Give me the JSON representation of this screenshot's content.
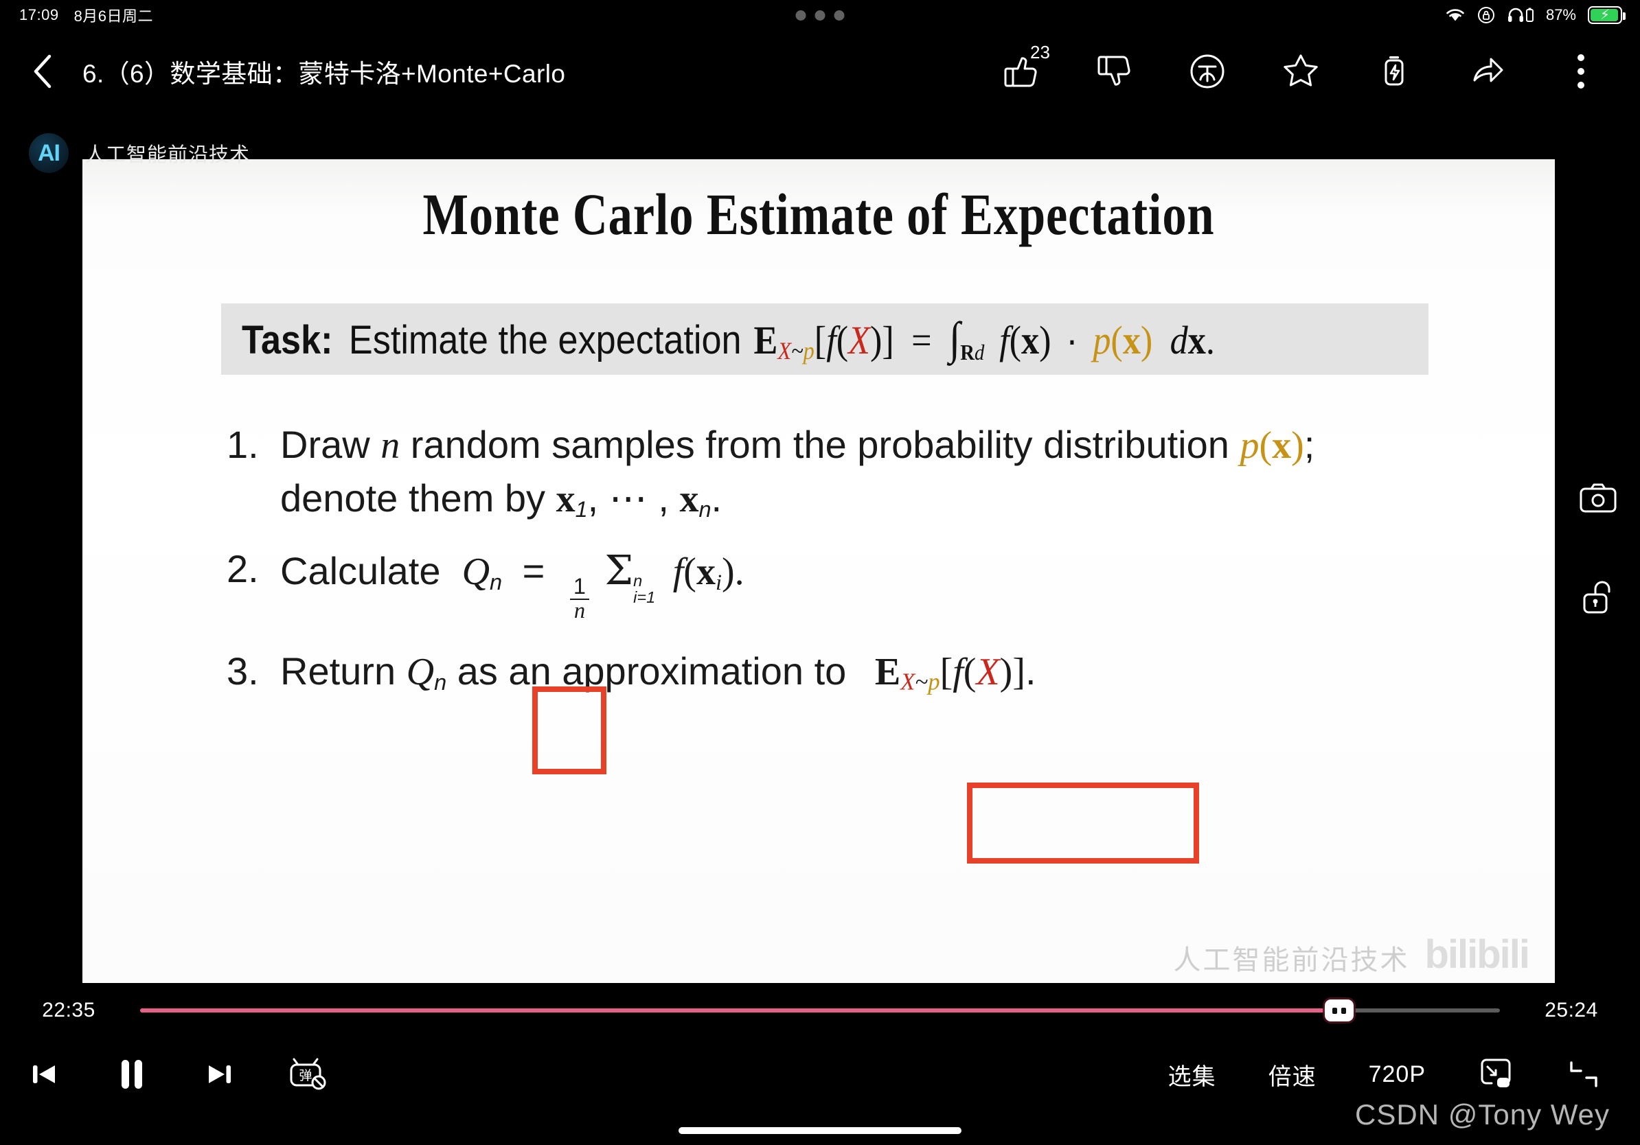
{
  "status_bar": {
    "time": "17:09",
    "date": "8月6日周二",
    "battery_percent": "87%",
    "icons": [
      "wifi-icon",
      "rotation-lock-icon",
      "headphones-battery-icon",
      "battery-charging-icon"
    ]
  },
  "top_bar": {
    "back_icon": "back-chevron-icon",
    "title": "6.（6）数学基础：蒙特卡洛+Monte+Carlo",
    "actions": [
      {
        "name": "like-button",
        "icon": "thumbs-up-icon",
        "count": "23"
      },
      {
        "name": "dislike-button",
        "icon": "thumbs-down-icon"
      },
      {
        "name": "coin-button",
        "icon": "coin-circle-icon"
      },
      {
        "name": "favorite-button",
        "icon": "star-icon"
      },
      {
        "name": "charge-button",
        "icon": "battery-bolt-icon"
      },
      {
        "name": "share-button",
        "icon": "share-arrow-icon"
      },
      {
        "name": "more-button",
        "icon": "three-dots-vertical-icon"
      }
    ]
  },
  "watermark": {
    "channel_logo": "AI",
    "channel_name": "人工智能前沿技术",
    "bottom_channel": "人工智能前沿技术",
    "bilibili": "bilibili",
    "csdn": "CSDN @Tony Wey"
  },
  "slide": {
    "title": "Monte Carlo Estimate of Expectation",
    "task_label": "Task:",
    "task_text": "Estimate the expectation",
    "task_formula": "E_{X~p}[f(X)] = ∫_{R^d} f(x) · p(x) dx.",
    "steps": [
      {
        "num": "1.",
        "line1": "Draw n random samples from the probability distribution p(x);",
        "line2": "denote them by x₁, ⋯ , xₙ."
      },
      {
        "num": "2.",
        "line1": "Calculate Qₙ = (1/n) Σ_{i=1}^{n} f(xᵢ)."
      },
      {
        "num": "3.",
        "line1": "Return Qₙ as an approximation to E_{X~p}[f(X)]."
      }
    ],
    "highlight_boxes": [
      "Qn-box",
      "expectation-box"
    ],
    "highlight_color": "#e8412a",
    "accent_red": "#c8291c",
    "accent_gold": "#c69316"
  },
  "side_controls": [
    {
      "name": "screenshot-button",
      "icon": "camera-icon"
    },
    {
      "name": "lock-button",
      "icon": "unlock-icon"
    }
  ],
  "player": {
    "current_time": "22:35",
    "total_time": "25:24",
    "progress_percent": 88,
    "progress_color": "#e8608a",
    "controls": [
      {
        "name": "previous-button",
        "icon": "skip-previous-icon"
      },
      {
        "name": "pause-button",
        "icon": "pause-icon"
      },
      {
        "name": "next-button",
        "icon": "skip-next-icon"
      },
      {
        "name": "danmaku-toggle-button",
        "icon": "danmaku-off-icon"
      }
    ],
    "right_controls": [
      {
        "name": "episode-list-button",
        "label": "选集"
      },
      {
        "name": "playback-speed-button",
        "label": "倍速"
      },
      {
        "name": "quality-button",
        "label": "720P"
      },
      {
        "name": "picture-in-picture-button",
        "icon": "pip-icon"
      },
      {
        "name": "fit-screen-button",
        "icon": "fit-screen-icon"
      }
    ]
  }
}
